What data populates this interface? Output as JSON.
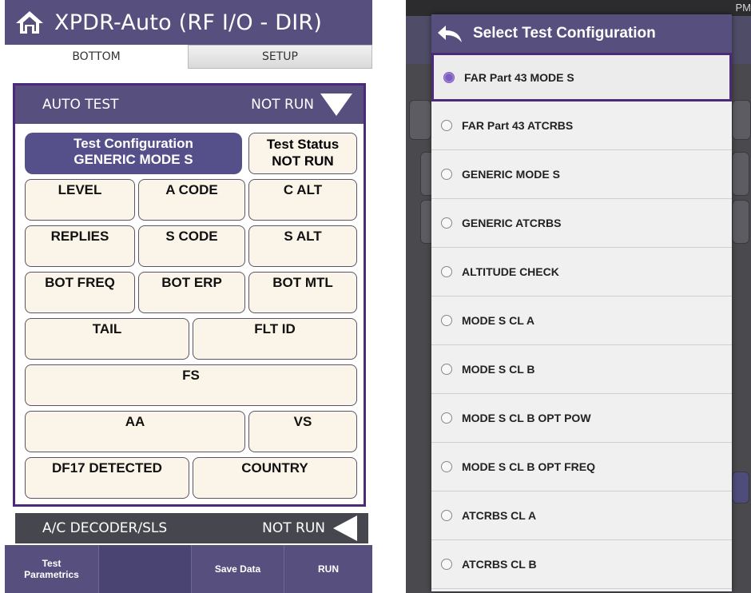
{
  "left": {
    "header": {
      "title": "XPDR-Auto (RF I/O - DIR)"
    },
    "tabs": [
      {
        "label": "BOTTOM",
        "active": true
      },
      {
        "label": "SETUP",
        "active": false
      }
    ],
    "auto_test": {
      "label": "AUTO TEST",
      "status": "NOT RUN"
    },
    "test_configuration": {
      "label": "Test Configuration",
      "value": "GENERIC MODE S"
    },
    "test_status": {
      "label": "Test Status",
      "value": "NOT RUN"
    },
    "fields": {
      "level": "LEVEL",
      "a_code": "A CODE",
      "c_alt": "C ALT",
      "replies": "REPLIES",
      "s_code": "S CODE",
      "s_alt": "S ALT",
      "bot_freq": "BOT FREQ",
      "bot_erp": "BOT ERP",
      "bot_mtl": "BOT MTL",
      "tail": "TAIL",
      "flt_id": "FLT ID",
      "fs": "FS",
      "aa": "AA",
      "vs": "VS",
      "df17": "DF17 DETECTED",
      "country": "COUNTRY"
    },
    "ac_decoder": {
      "label": "A/C DECODER/SLS",
      "status": "NOT RUN"
    },
    "bottom_bar": {
      "test_parametrics_line1": "Test",
      "test_parametrics_line2": "Parametrics",
      "save_data": "Save Data",
      "run": "RUN"
    }
  },
  "right": {
    "status_bar": {
      "clock": "PM"
    },
    "dialog": {
      "title": "Select Test Configuration",
      "options": [
        {
          "label": "FAR Part 43 MODE S",
          "selected": true
        },
        {
          "label": "FAR Part 43 ATCRBS",
          "selected": false
        },
        {
          "label": "GENERIC MODE S",
          "selected": false
        },
        {
          "label": "GENERIC ATCRBS",
          "selected": false
        },
        {
          "label": "ALTITUDE CHECK",
          "selected": false
        },
        {
          "label": "MODE S CL A",
          "selected": false
        },
        {
          "label": "MODE S CL B",
          "selected": false
        },
        {
          "label": "MODE S CL B OPT POW",
          "selected": false
        },
        {
          "label": "MODE S CL B OPT FREQ",
          "selected": false
        },
        {
          "label": "ATCRBS CL A",
          "selected": false
        },
        {
          "label": "ATCRBS CL B",
          "selected": false
        }
      ]
    }
  },
  "colors": {
    "header": "#57507f",
    "panel_border": "#4b2a7a",
    "cell_bg": "#fbf4e8",
    "radio_selected": "#7d5bbf"
  }
}
